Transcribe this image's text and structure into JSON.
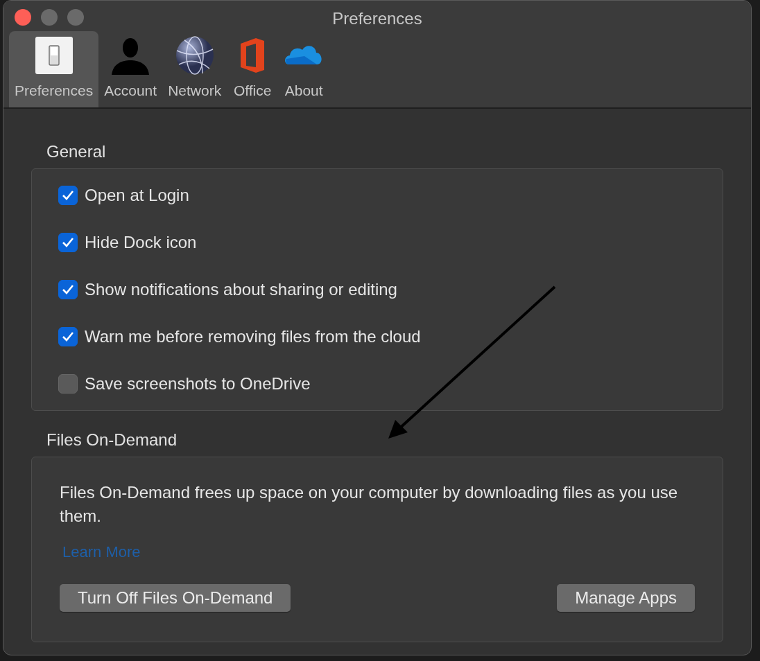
{
  "window": {
    "title": "Preferences"
  },
  "tabs": [
    {
      "label": "Preferences",
      "kind": "switch",
      "selected": true
    },
    {
      "label": "Account",
      "kind": "person",
      "selected": false
    },
    {
      "label": "Network",
      "kind": "globe",
      "selected": false
    },
    {
      "label": "Office",
      "kind": "office",
      "selected": false
    },
    {
      "label": "About",
      "kind": "cloud",
      "selected": false
    }
  ],
  "general": {
    "title": "General",
    "options": [
      {
        "label": "Open at Login",
        "checked": true
      },
      {
        "label": "Hide Dock icon",
        "checked": true
      },
      {
        "label": "Show notifications about sharing or editing",
        "checked": true
      },
      {
        "label": "Warn me before removing files from the cloud",
        "checked": true
      },
      {
        "label": "Save screenshots to OneDrive",
        "checked": false
      }
    ]
  },
  "files_on_demand": {
    "title": "Files On-Demand",
    "description": "Files On-Demand frees up space on your computer by downloading files as you use them.",
    "link": "Learn More",
    "buttons": [
      "Turn Off Files On-Demand",
      "Manage Apps"
    ]
  }
}
